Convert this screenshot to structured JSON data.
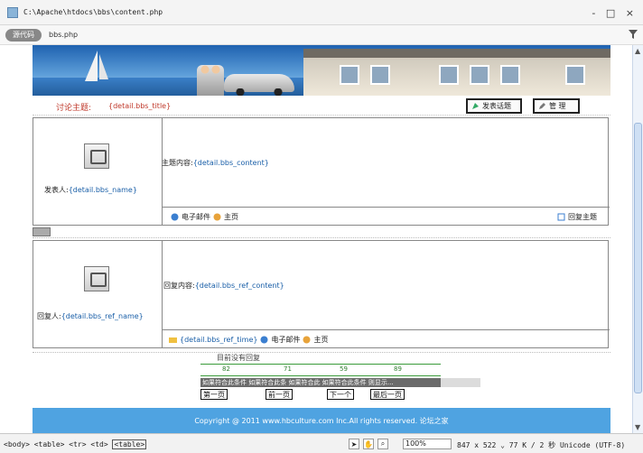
{
  "window": {
    "title_path": "C:\\Apache\\htdocs\\bbs\\content.php",
    "controls": "- □ ×"
  },
  "tabbar": {
    "code_tab": "源代码",
    "file_name": "bbs.php"
  },
  "topic": {
    "label": "讨论主题:",
    "value": "{detail.bbs_title}",
    "post_button": "发表话题",
    "manage_button": "管  理"
  },
  "topic_box": {
    "poster_label": "发表人:",
    "poster_value": "{detail.bbs_name}",
    "content_label": "主题内容:",
    "content_value": "{detail.bbs_content}",
    "email": "电子邮件",
    "homepage": "主页",
    "reply_topic": "回复主题"
  },
  "reply_box": {
    "replier_label": "回复人:",
    "replier_value": "{detail.bbs_ref_name}",
    "content_label": "回复内容:",
    "content_value": "{detail.bbs_ref_content}",
    "time_value": "{detail.bbs_ref_time}",
    "email": "电子邮件",
    "homepage": "主页"
  },
  "nav": {
    "no_record": "目前没有回复",
    "widths": [
      "82",
      "71",
      "59",
      "89"
    ],
    "condition_text": "如果符合此条件 如果符合此条 如果符合此 如果符合此条件 则显示...",
    "first": "第一页",
    "prev": "前一页",
    "next": "下一个",
    "last": "最后一页"
  },
  "footer": {
    "copyright": "Copyright @ 2011 www.hbculture.com Inc.All rights reserved. 论坛之家"
  },
  "statusbar": {
    "tags": [
      "<body>",
      "<table>",
      "<tr>",
      "<td>"
    ],
    "current_tag": "<table>",
    "zoom": "100%",
    "info": "847 x 522 ⌄ 77 K / 2 秒  Unicode (UTF-8)"
  },
  "colors": {
    "footer": "#4fa3e1",
    "topic_label": "#c0392b",
    "binding_text": "#1a5fa8"
  }
}
